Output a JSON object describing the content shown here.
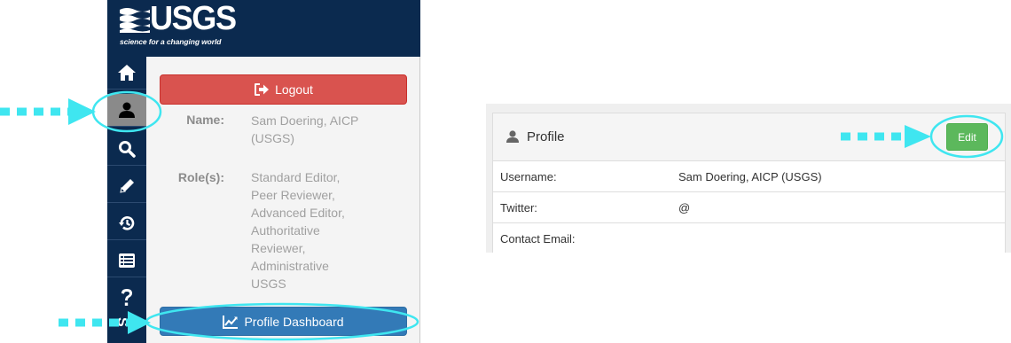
{
  "logo": {
    "name": "USGS",
    "tagline": "science for a changing world"
  },
  "nav_rail": {
    "items": [
      {
        "id": "home",
        "icon": "home-icon"
      },
      {
        "id": "profile",
        "icon": "user-icon",
        "active": true
      },
      {
        "id": "search",
        "icon": "search-icon"
      },
      {
        "id": "edit",
        "icon": "pencil-icon"
      },
      {
        "id": "history",
        "icon": "history-icon"
      },
      {
        "id": "list",
        "icon": "list-icon"
      },
      {
        "id": "help",
        "icon": "question-icon"
      }
    ],
    "partial_text": "S"
  },
  "user_panel": {
    "logout_label": "Logout",
    "name_label": "Name:",
    "name_value_lines": [
      "Sam Doering, AICP",
      "(USGS)"
    ],
    "roles_label": "Role(s):",
    "roles_lines": [
      "Standard Editor,",
      "Peer Reviewer,",
      "Advanced Editor,",
      "Authoritative",
      "Reviewer,",
      "Administrative",
      "USGS"
    ],
    "dashboard_label": "Profile Dashboard"
  },
  "profile_card": {
    "title": "Profile",
    "edit_label": "Edit",
    "rows": [
      {
        "key": "Username:",
        "value": "Sam Doering, AICP (USGS)"
      },
      {
        "key": "Twitter:",
        "value": "@"
      },
      {
        "key": "Contact Email:",
        "value": ""
      }
    ]
  },
  "colors": {
    "navy": "#0b2a4f",
    "logout_red": "#d9534f",
    "dashboard_blue": "#337ab7",
    "edit_green": "#5cb85c",
    "annotation_cyan": "#3fe6f0"
  }
}
